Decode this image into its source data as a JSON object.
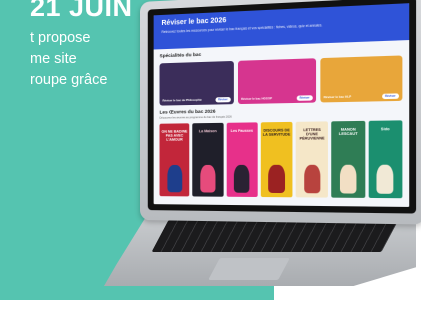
{
  "promo": {
    "heading": "21 JUIN",
    "lines": [
      "t propose",
      "me site",
      "roupe grâce"
    ]
  },
  "site": {
    "title": "Réviser le bac 2026",
    "subtitle": "Retrouvez toutes les ressources pour réviser le bac français et vos spécialités : fiches, vidéos, quiz et annales.",
    "specialites": {
      "title": "Spécialités du bac",
      "cards": [
        {
          "label": "Réviser le bac de Philosophie",
          "button": "Réviser",
          "color": "#3b2d5a"
        },
        {
          "label": "Réviser le bac HGGSP",
          "button": "Réviser",
          "color": "#d6358f"
        },
        {
          "label": "Réviser le bac HLP",
          "button": "Réviser",
          "color": "#e8a63a"
        }
      ]
    },
    "oeuvres": {
      "title": "Les Œuvres du bac 2026",
      "subtitle": "Découvrez les œuvres au programme du bac de français 2026",
      "books": [
        {
          "title": "ON NE BADINE PAS AVEC L'AMOUR",
          "bg": "#c2263a",
          "fg": "#ffffff",
          "fig": "#1e3e8c"
        },
        {
          "title": "La Maison",
          "bg": "#1f1f2a",
          "fg": "#f0c6d3",
          "fig": "#e64b7c"
        },
        {
          "title": "Les Fausses",
          "bg": "#e7308a",
          "fg": "#ffffff",
          "fig": "#2a2233"
        },
        {
          "title": "DISCOURS DE LA SERVITUDE",
          "bg": "#f0c020",
          "fg": "#2b1d1d",
          "fig": "#9b2222"
        },
        {
          "title": "LETTRES D'UNE PÉRUVIENNE",
          "bg": "#f5e7c8",
          "fg": "#3a1f1f",
          "fig": "#b8433e"
        },
        {
          "title": "MANON LESCAUT",
          "bg": "#2f7d55",
          "fg": "#ffffff",
          "fig": "#f2dfc4"
        },
        {
          "title": "Sido",
          "bg": "#1b8f6f",
          "fg": "#ffffff",
          "fig": "#f1e9d6"
        }
      ]
    }
  },
  "colors": {
    "teal": "#55c4b0",
    "header_blue": "#2f53d8"
  }
}
